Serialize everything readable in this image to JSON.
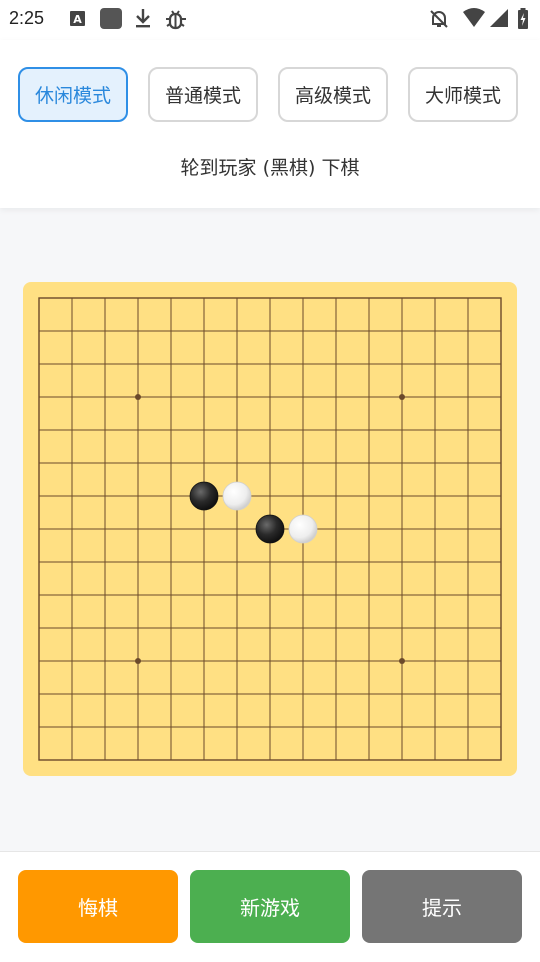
{
  "status_bar": {
    "time": "2:25",
    "left_icons": [
      "text-a-icon",
      "app-square-icon",
      "download-icon",
      "bug-icon"
    ],
    "right_icons": [
      "bell-off-icon",
      "wifi-icon",
      "signal-icon",
      "battery-icon"
    ]
  },
  "modes": [
    {
      "label": "休闲模式",
      "active": true
    },
    {
      "label": "普通模式",
      "active": false
    },
    {
      "label": "高级模式",
      "active": false
    },
    {
      "label": "大师模式",
      "active": false
    }
  ],
  "turn_text": "轮到玩家 (黑棋) 下棋",
  "board": {
    "size": 15,
    "star_points": [
      [
        3,
        3
      ],
      [
        11,
        3
      ],
      [
        3,
        11
      ],
      [
        11,
        11
      ]
    ],
    "stones": [
      {
        "col": 5,
        "row": 6,
        "color": "black"
      },
      {
        "col": 6,
        "row": 6,
        "color": "white"
      },
      {
        "col": 7,
        "row": 7,
        "color": "black"
      },
      {
        "col": 8,
        "row": 7,
        "color": "white"
      }
    ],
    "colors": {
      "board": "#ffe083",
      "line": "#6b4a2b"
    }
  },
  "actions": [
    {
      "label": "悔棋",
      "color": "#ff9800"
    },
    {
      "label": "新游戏",
      "color": "#4caf50"
    },
    {
      "label": "提示",
      "color": "#757575"
    }
  ]
}
